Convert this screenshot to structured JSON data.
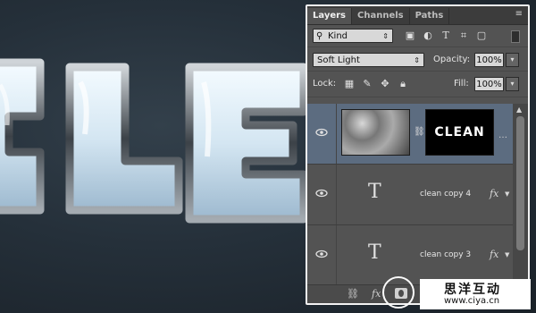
{
  "panel": {
    "tabs": [
      "Layers",
      "Channels",
      "Paths"
    ],
    "active_tab": "Layers",
    "filter": {
      "label": "Kind"
    },
    "blend_mode": "Soft Light",
    "opacity_label": "Opacity:",
    "opacity_value": "100%",
    "lock_label": "Lock:",
    "fill_label": "Fill:",
    "fill_value": "100%",
    "layers": [
      {
        "type": "image-with-mask",
        "mask_text": "CLEAN",
        "selected": true
      },
      {
        "type": "text",
        "name": "clean copy 4",
        "fx": "fx"
      },
      {
        "type": "text",
        "name": "clean copy 3",
        "fx": "fx"
      }
    ]
  },
  "canvas": {
    "letters": [
      "C",
      "L",
      "E"
    ]
  },
  "watermark": {
    "text": "思洋互动",
    "url": "www.ciya.cn"
  },
  "colors": {
    "panel_bg": "#535353",
    "selected_layer": "#5c6c80",
    "canvas_bg": "#25303a"
  }
}
